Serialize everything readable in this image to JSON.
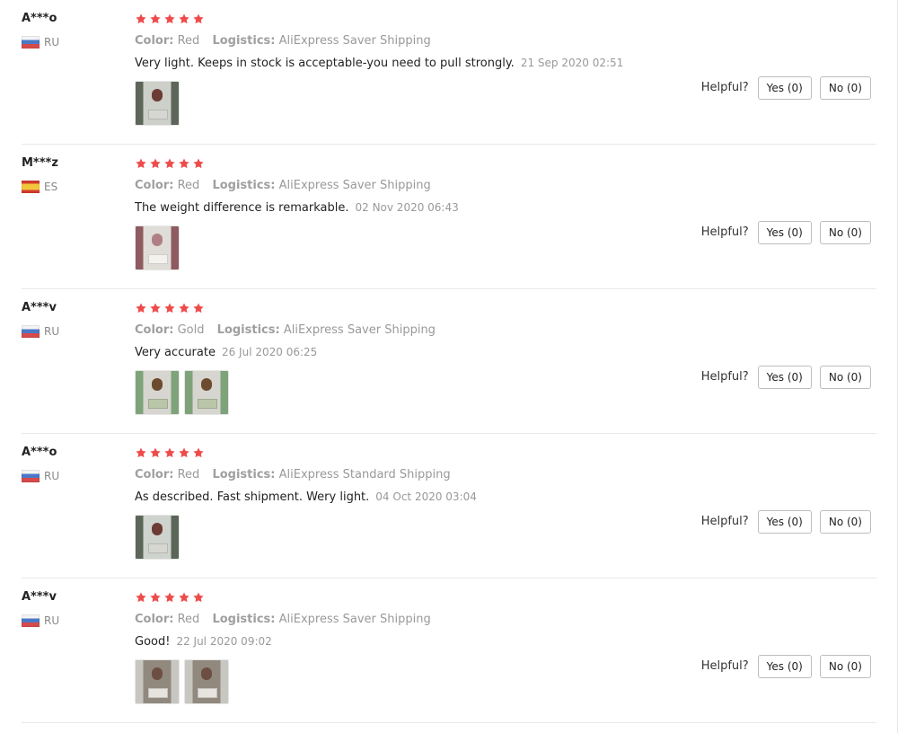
{
  "reviews": [
    {
      "username": "A***o",
      "country": "RU",
      "flag": "russia-flag",
      "rating": 5,
      "color_label": "Color:",
      "color_value": "Red",
      "logistics_label": "Logistics:",
      "logistics_value": "AliExpress Saver Shipping",
      "text": "Very light. Keeps in stock is acceptable-you need to pull strongly.",
      "date": "21 Sep 2020 02:51",
      "photos": 1,
      "helpful_label": "Helpful?",
      "yes_label": "Yes (0)",
      "no_label": "No (0)"
    },
    {
      "username": "M***z",
      "country": "ES",
      "flag": "spain-flag",
      "rating": 5,
      "color_label": "Color:",
      "color_value": "Red",
      "logistics_label": "Logistics:",
      "logistics_value": "AliExpress Saver Shipping",
      "text": "The weight difference is remarkable.",
      "date": "02 Nov 2020 06:43",
      "photos": 1,
      "helpful_label": "Helpful?",
      "yes_label": "Yes (0)",
      "no_label": "No (0)"
    },
    {
      "username": "A***v",
      "country": "RU",
      "flag": "russia-flag",
      "rating": 5,
      "color_label": "Color:",
      "color_value": "Gold",
      "logistics_label": "Logistics:",
      "logistics_value": "AliExpress Saver Shipping",
      "text": "Very accurate",
      "date": "26 Jul 2020 06:25",
      "photos": 2,
      "helpful_label": "Helpful?",
      "yes_label": "Yes (0)",
      "no_label": "No (0)"
    },
    {
      "username": "A***o",
      "country": "RU",
      "flag": "russia-flag",
      "rating": 5,
      "color_label": "Color:",
      "color_value": "Red",
      "logistics_label": "Logistics:",
      "logistics_value": "AliExpress Standard Shipping",
      "text": "As described. Fast shipment. Wery light.",
      "date": "04 Oct 2020 03:04",
      "photos": 1,
      "helpful_label": "Helpful?",
      "yes_label": "Yes (0)",
      "no_label": "No (0)"
    },
    {
      "username": "A***v",
      "country": "RU",
      "flag": "russia-flag",
      "rating": 5,
      "color_label": "Color:",
      "color_value": "Red",
      "logistics_label": "Logistics:",
      "logistics_value": "AliExpress Saver Shipping",
      "text": "Good!",
      "date": "22 Jul 2020 09:02",
      "photos": 2,
      "helpful_label": "Helpful?",
      "yes_label": "Yes (0)",
      "no_label": "No (0)"
    }
  ],
  "colors": {
    "star": "#ef4b4b",
    "text": "#222222",
    "muted": "#999999",
    "border": "#bdbdbd",
    "divider": "#e8e8e8"
  },
  "icons": {
    "star": "star-icon",
    "photo": "review-photo"
  }
}
